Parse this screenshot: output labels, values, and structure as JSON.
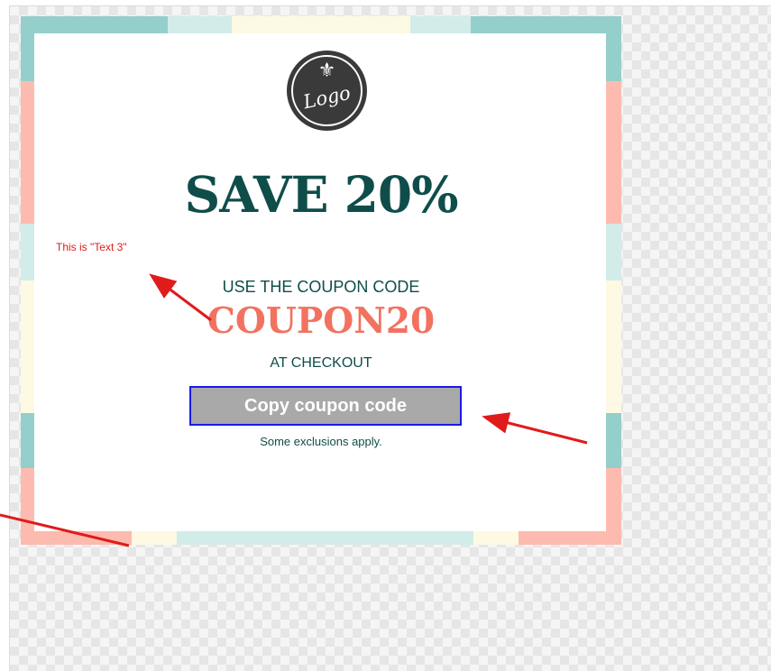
{
  "coupon": {
    "logo_text": "Logo",
    "logo_glyph": "⚜",
    "headline": "SAVE 20%",
    "intro": "USE THE COUPON CODE",
    "code": "COUPON20",
    "outro": "AT CHECKOUT",
    "copy_button_label": "Copy coupon code",
    "fineprint": "Some exclusions apply."
  },
  "annotation": {
    "label": "This is \"Text 3\""
  },
  "colors": {
    "teal_dark": "#0f4d4a",
    "coral": "#f2725f",
    "frame_teal": "#95cfcb",
    "frame_mint": "#d2ecea",
    "frame_cream": "#fdf9e3",
    "frame_pink": "#fdbbb0",
    "annotation_red": "#e01b1b",
    "button_gray": "#a9a9a9",
    "button_border": "#1a1ae6"
  }
}
